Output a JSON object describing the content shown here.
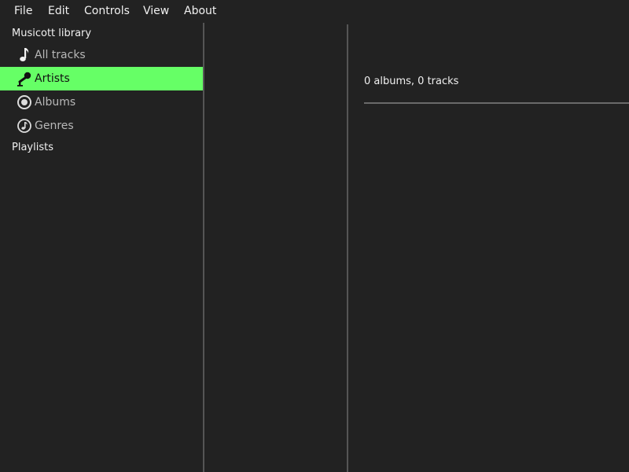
{
  "menubar": {
    "items": [
      "File",
      "Edit",
      "Controls",
      "View",
      "About"
    ]
  },
  "sidebar": {
    "library_header": "Musicott library",
    "items": [
      {
        "label": "All tracks",
        "icon": "music-note-icon",
        "selected": false
      },
      {
        "label": "Artists",
        "icon": "microphone-icon",
        "selected": true
      },
      {
        "label": "Albums",
        "icon": "disc-icon",
        "selected": false
      },
      {
        "label": "Genres",
        "icon": "music-circle-icon",
        "selected": false
      }
    ],
    "playlists_header": "Playlists"
  },
  "detail": {
    "summary": "0 albums, 0 tracks"
  },
  "colors": {
    "background": "#222222",
    "selection": "#66ff66",
    "divider": "#555555"
  }
}
